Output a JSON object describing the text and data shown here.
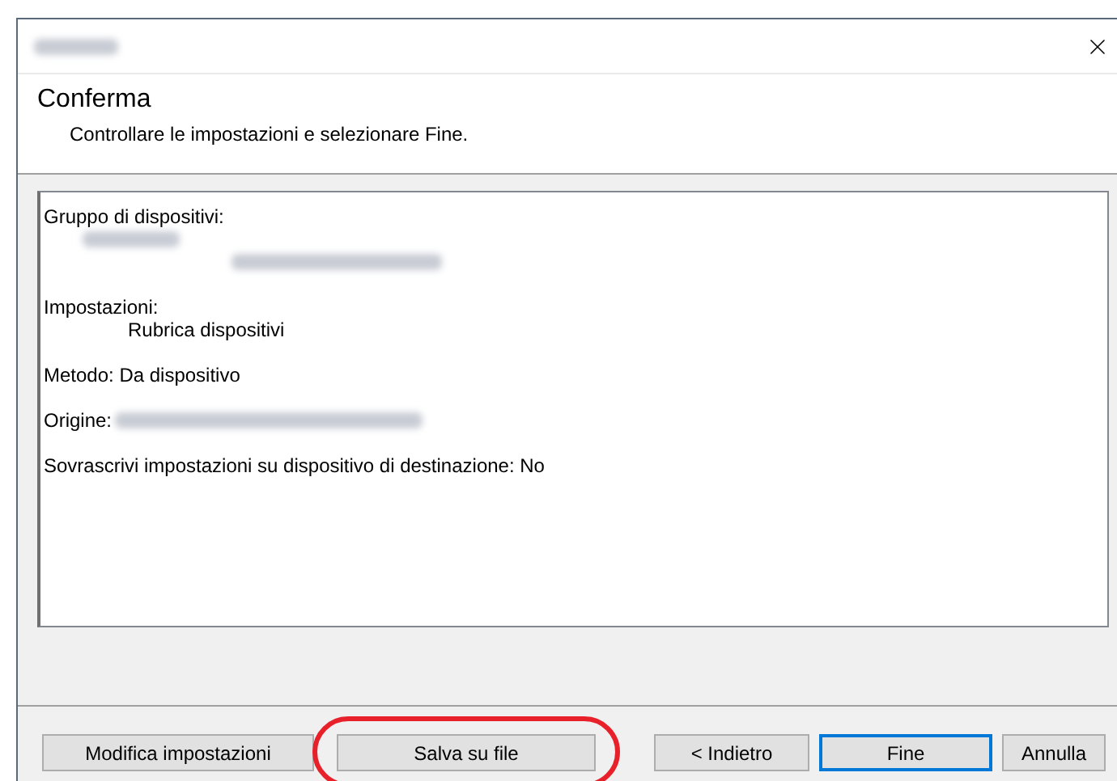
{
  "header": {
    "title": "Conferma",
    "subtitle": "Controllare le impostazioni e selezionare Fine."
  },
  "summary": [
    {
      "kind": "label",
      "text": "Gruppo di dispositivi:"
    },
    {
      "kind": "blurred_group"
    },
    {
      "kind": "blurred_device"
    },
    {
      "kind": "gap"
    },
    {
      "kind": "label",
      "text": "Impostazioni:"
    },
    {
      "kind": "value",
      "text": "Rubrica dispositivi"
    },
    {
      "kind": "gap"
    },
    {
      "kind": "label",
      "text": "Metodo: Da dispositivo"
    },
    {
      "kind": "gap"
    },
    {
      "kind": "label_blurred",
      "text": "Origine:"
    },
    {
      "kind": "gap"
    },
    {
      "kind": "label",
      "text": "Sovrascrivi impostazioni su dispositivo di destinazione: No"
    }
  ],
  "buttons": [
    {
      "label": "Modifica impostazioni",
      "default": false,
      "highlighted": false
    },
    {
      "label": "Salva su file",
      "default": false,
      "highlighted": true
    },
    {
      "label": "< Indietro",
      "default": false,
      "highlighted": false
    },
    {
      "label": "Fine",
      "default": true,
      "highlighted": false
    },
    {
      "label": "Annulla",
      "default": false,
      "highlighted": false
    }
  ]
}
